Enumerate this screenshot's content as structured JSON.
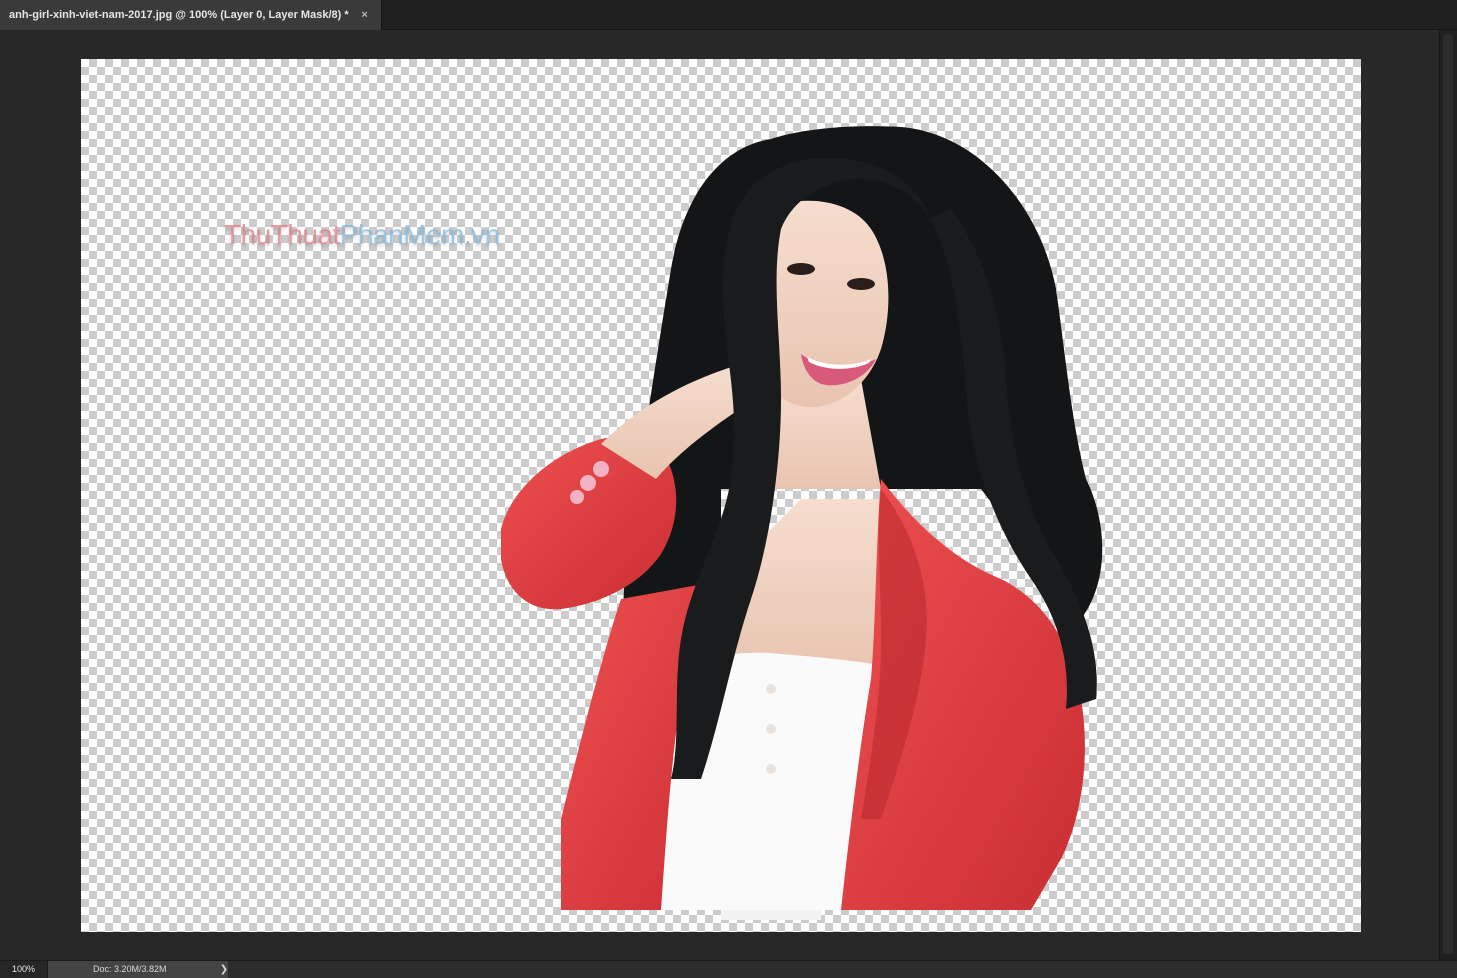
{
  "document_tab": {
    "title": "anh-girl-xinh-viet-nam-2017.jpg @ 100% (Layer 0, Layer Mask/8) *",
    "close_glyph": "×",
    "close_icon": "close-icon"
  },
  "canvas": {
    "watermark": {
      "part_a": "ThuThuat",
      "part_b": "PhanMem.vn",
      "color_a": "#e07a86",
      "color_b": "#7fb6dd"
    },
    "transparency_checker_colors": [
      "#ffffff",
      "#cccccc"
    ],
    "subject_colors": {
      "hair": "#141516",
      "skin": "#f1d6c6",
      "blazer": "#e23e3e",
      "top": "#fafafa"
    }
  },
  "status_bar": {
    "zoom": "100%",
    "doc_info": "Doc: 3.20M/3.82M",
    "menu_glyph": "❯",
    "menu_icon": "chevron-right-icon"
  }
}
